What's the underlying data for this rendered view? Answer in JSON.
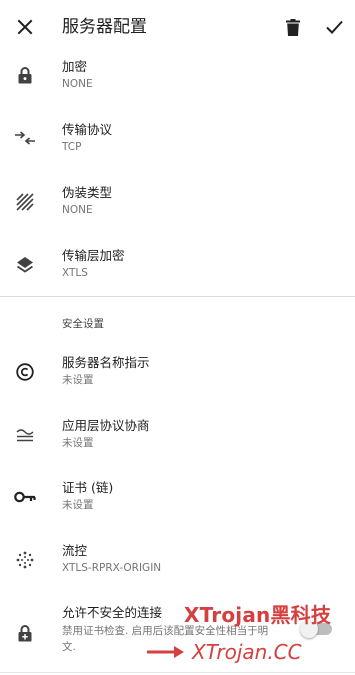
{
  "app_bar": {
    "title": "服务器配置",
    "close_icon": "close-icon",
    "delete_icon": "trash-icon",
    "confirm_icon": "check-icon"
  },
  "settings": [
    {
      "icon": "lock-icon",
      "title": "加密",
      "value": "NONE"
    },
    {
      "icon": "transfer-arrows-icon",
      "title": "传输协议",
      "value": "TCP"
    },
    {
      "icon": "hatch-icon",
      "title": "伪装类型",
      "value": "NONE"
    },
    {
      "icon": "layers-icon",
      "title": "传输层加密",
      "value": "XTLS"
    }
  ],
  "security_section": {
    "header": "安全设置",
    "items": [
      {
        "icon": "copyright-icon",
        "title": "服务器名称指示",
        "value": "未设置"
      },
      {
        "icon": "approx-equal-icon",
        "title": "应用层协议协商",
        "value": "未设置"
      },
      {
        "icon": "key-icon",
        "title": "证书 (链)",
        "value": "未设置"
      },
      {
        "icon": "flow-dots-icon",
        "title": "流控",
        "value": "XTLS-RPRX-ORIGIN"
      }
    ],
    "insecure": {
      "icon": "lock-plus-icon",
      "title": "允许不安全的连接",
      "desc_line1": "禁用证书检查. 启用后该配置安全性相当于明",
      "desc_line2": "文.",
      "toggle_on": false
    }
  },
  "watermark": {
    "line1": "XTrojan黑科技",
    "line2": "XTrojan.CC",
    "color": "#d32f2f"
  }
}
